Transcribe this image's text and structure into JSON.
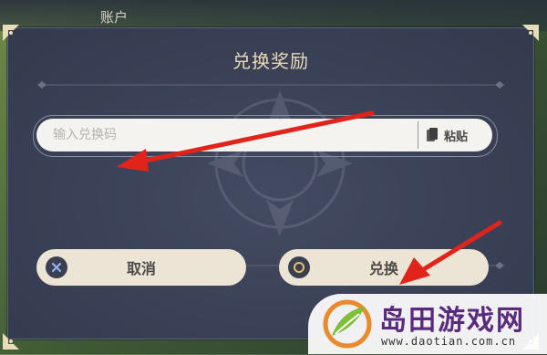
{
  "background": {
    "tab_label": "账户"
  },
  "dialog": {
    "title": "兑换奖励",
    "input": {
      "value": "",
      "placeholder": "输入兑换码"
    },
    "paste_label": "粘贴",
    "buttons": {
      "cancel_label": "取消",
      "confirm_label": "兑换"
    }
  },
  "watermark": {
    "name": "岛田游戏网",
    "url": "www.daotian.com.cn"
  },
  "colors": {
    "dialog_bg": "#3a4156",
    "title": "#e8d9b6",
    "button_bg": "#ece4d4",
    "arrow": "#e0241b",
    "brand_purple": "#5a2a7e"
  },
  "icons": {
    "cancel": "close-circle-icon",
    "confirm": "circle-confirm-icon",
    "paste": "clipboard-icon"
  }
}
